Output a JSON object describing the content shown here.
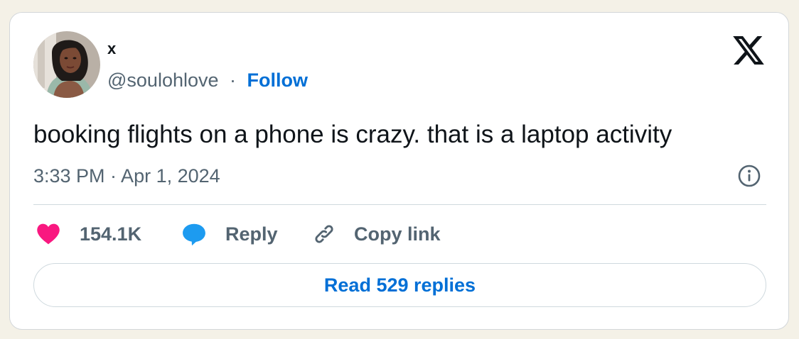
{
  "tweet": {
    "author": {
      "display_name": "x",
      "handle": "@soulohlove",
      "separator": "·",
      "follow_label": "Follow"
    },
    "text": "booking flights on a phone is crazy. that is a laptop activity",
    "timestamp": "3:33 PM · Apr 1, 2024",
    "logo_icon": "x-logo-icon",
    "info_icon": "info-icon"
  },
  "actions": {
    "like": {
      "icon": "heart-icon",
      "count": "154.1K",
      "color": "#f91880"
    },
    "reply": {
      "icon": "speech-bubble-icon",
      "label": "Reply",
      "color": "#1d9bf0"
    },
    "copy_link": {
      "icon": "link-icon",
      "label": "Copy link"
    }
  },
  "replies_button": {
    "label": "Read 529 replies"
  },
  "colors": {
    "link_blue": "#006fd6",
    "text_primary": "#0f1419",
    "text_secondary": "#536471",
    "page_background": "#f4f1e7"
  }
}
